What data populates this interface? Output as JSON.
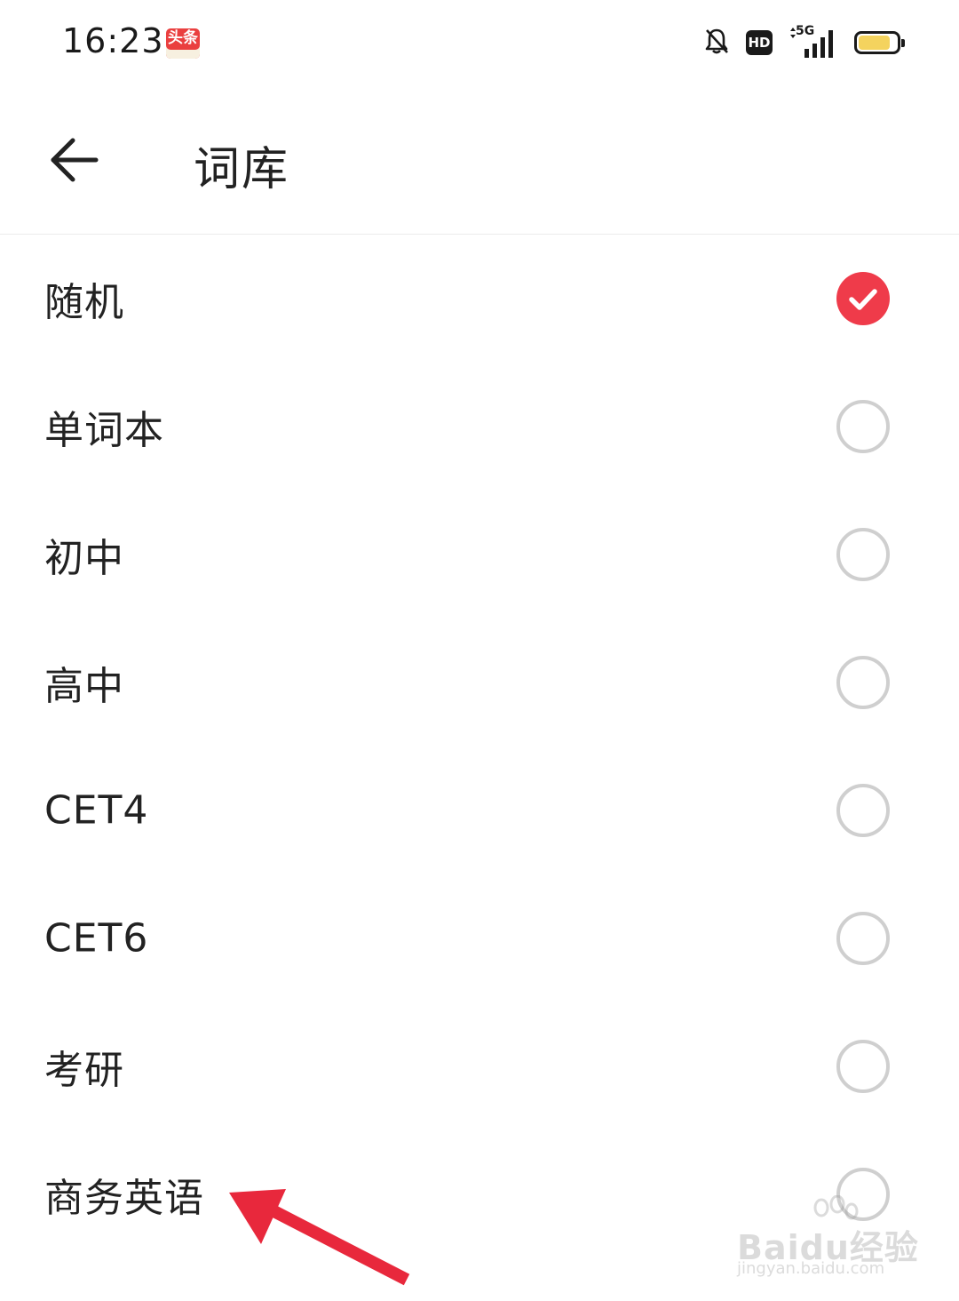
{
  "status_bar": {
    "time": "16:23",
    "app_badge": "头条",
    "hd_label": "HD",
    "network_label": "5G",
    "battery_level": 0.85
  },
  "header": {
    "title": "词库"
  },
  "word_banks": [
    {
      "label": "随机",
      "selected": true
    },
    {
      "label": "单词本",
      "selected": false
    },
    {
      "label": "初中",
      "selected": false
    },
    {
      "label": "高中",
      "selected": false
    },
    {
      "label": "CET4",
      "selected": false
    },
    {
      "label": "CET6",
      "selected": false
    },
    {
      "label": "考研",
      "selected": false
    },
    {
      "label": "商务英语",
      "selected": false
    }
  ],
  "colors": {
    "accent": "#ef3b4a",
    "annotation_arrow": "#e8283c"
  },
  "watermark": {
    "brand": "Baidu经验",
    "url": "jingyan.baidu.com"
  }
}
